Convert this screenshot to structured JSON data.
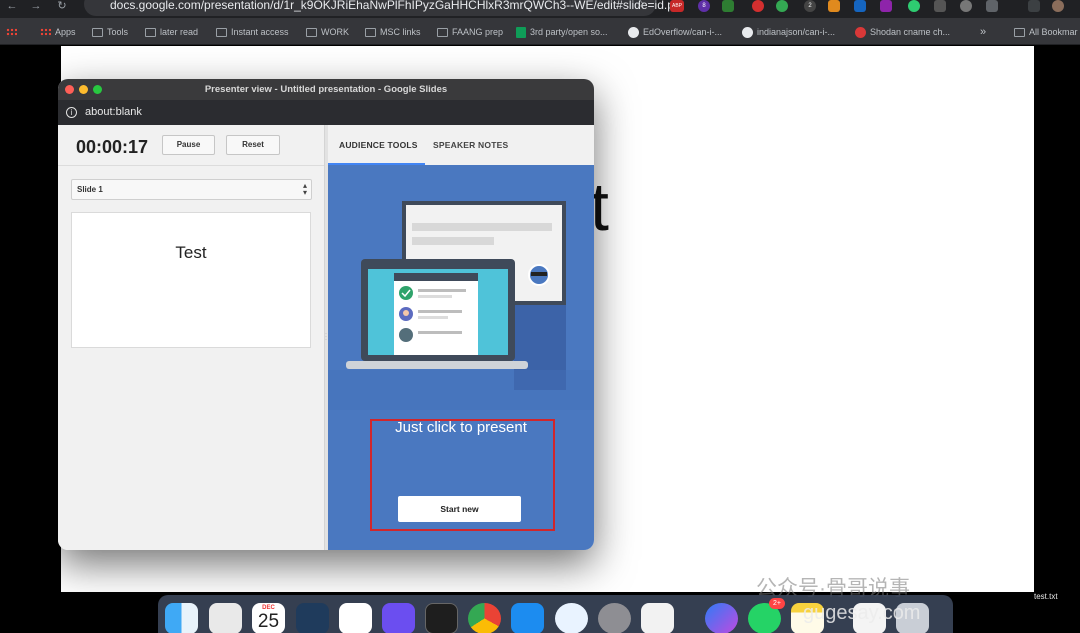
{
  "browser": {
    "url": "docs.google.com/presentation/d/1r_k9OKJRiEhaNwPlFhIPyzGaHHCHlxR3mrQWCh3--WE/edit#slide=id.p",
    "bookmarks": [
      {
        "label": "Apps",
        "icon": "apps-grid-icon"
      },
      {
        "label": "Tools",
        "icon": "folder-icon"
      },
      {
        "label": "later read",
        "icon": "folder-icon"
      },
      {
        "label": "Instant access",
        "icon": "folder-icon"
      },
      {
        "label": "WORK",
        "icon": "folder-icon"
      },
      {
        "label": "MSC links",
        "icon": "folder-icon"
      },
      {
        "label": "FAANG prep",
        "icon": "folder-icon"
      },
      {
        "label": "3rd party/open so...",
        "icon": "sheets-icon"
      },
      {
        "label": "EdOverflow/can-i-...",
        "icon": "github-icon"
      },
      {
        "label": "indianajson/can-i-...",
        "icon": "github-icon"
      },
      {
        "label": "Shodan cname ch...",
        "icon": "shodan-icon"
      }
    ],
    "more_bookmarks": "»",
    "all_bookmarks": "All Bookmar",
    "extension_badges": {
      "abp": "ABP",
      "count_a": "8",
      "count_b": "2"
    }
  },
  "editor": {
    "background_text": "t"
  },
  "presenter": {
    "window_title": "Presenter view - Untitled presentation - Google Slides",
    "address": "about:blank",
    "timer": "00:00:17",
    "pause_label": "Pause",
    "reset_label": "Reset",
    "slide_select": "Slide 1",
    "thumbnail_text": "Test",
    "tabs": [
      {
        "label": "AUDIENCE TOOLS",
        "active": true
      },
      {
        "label": "SPEAKER NOTES",
        "active": false
      }
    ],
    "tagline": "Just click to present",
    "start_label": "Start new",
    "accent_blue": "#4a78c0",
    "highlight_red": "#d1262b"
  },
  "dock": {
    "calendar_month": "DEC",
    "calendar_day": "25",
    "whatsapp_badge": "2+",
    "file_label": "test.txt",
    "icons": [
      "finder-icon",
      "launchpad-icon",
      "calendar-icon",
      "copilot-icon",
      "slack-icon",
      "shortcut-icon",
      "terminal-icon",
      "chrome-icon",
      "appstore-icon",
      "safari-icon",
      "settings-icon",
      "phone-mirror-icon",
      "messenger-icon",
      "whatsapp-icon",
      "notes-icon",
      "text-file-icon",
      "trash-icon"
    ]
  },
  "watermark": {
    "text_cn": "公众号·骨哥说事",
    "text_site": "gugesay.com"
  }
}
